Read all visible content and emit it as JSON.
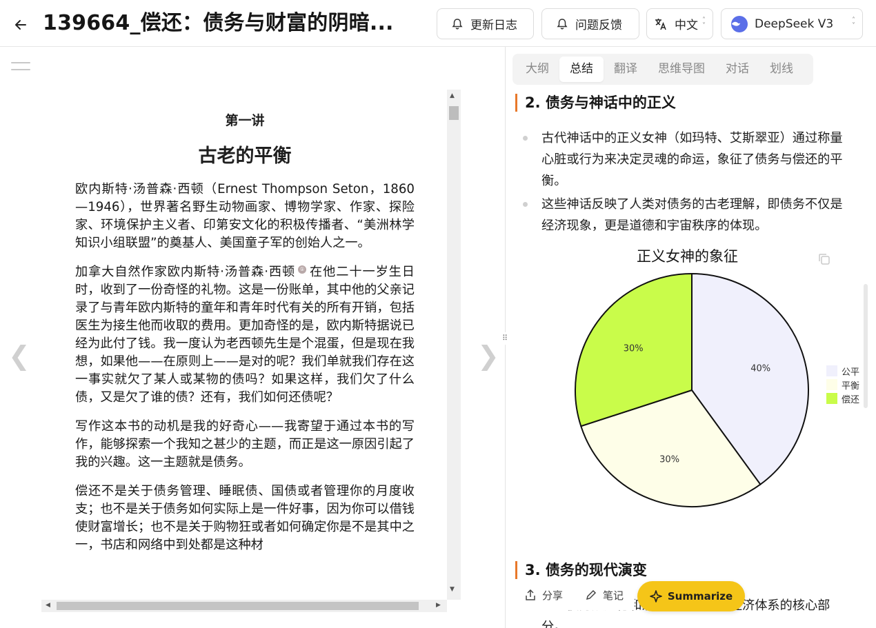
{
  "header": {
    "title": "139664_偿还：债务与财富的阴暗...",
    "changelog_label": "更新日志",
    "feedback_label": "问题反馈",
    "language_label": "中文",
    "model_label": "DeepSeek V3"
  },
  "reader": {
    "lecture": "第一讲",
    "chapter_title": "古老的平衡",
    "paragraphs": [
      "欧内斯特·汤普森·西顿（Ernest Thompson Seton，1860—1946），世界著名野生动物画家、博物学家、作家、探险家、环境保护主义者、印第安文化的积极传播者、“美洲林学知识小组联盟”的奠基人、美国童子军的创始人之一。",
      "在他二十一岁生日时，收到了一份奇怪的礼物。这是一份账单，其中他的父亲记录了与青年欧内斯特的童年和青年时代有关的所有开销，包括医生为接生他而收取的费用。更加奇怪的是，欧内斯特据说已经为此付了钱。我一度认为老西顿先生是个混蛋，但是现在我想，如果他——在原则上——是对的呢？我们单就我们存在这一事实就欠了某人或某物的债吗？如果这样，我们欠了什么债，又是欠了谁的债？还有，我们如何还债呢？",
      "写作这本书的动机是我的好奇心——我寄望于通过本书的写作，能够探索一个我知之甚少的主题，而正是这一原因引起了我的兴趣。这一主题就是债务。",
      "偿还不是关于债务管理、睡眠债、国债或者管理你的月度收支；也不是关于债务如何实际上是一件好事，因为你可以借钱使财富增长；也不是关于购物狂或者如何确定你是不是其中之一，书店和网络中到处都是这种材"
    ],
    "para2_prefix": "加拿大自然作家欧内斯特·汤普森·西顿",
    "note_marker": "①"
  },
  "tabs": [
    "大纲",
    "总结",
    "翻译",
    "思维导图",
    "对话",
    "划线"
  ],
  "active_tab": "总结",
  "summary": {
    "section2_title": "2. 债务与神话中的正义",
    "bullets": [
      "古代神话中的正义女神（如玛特、艾斯翠亚）通过称量心脏或行为来决定灵魂的命运，象征了债务与偿还的平衡。",
      "这些神话反映了人类对债务的古老理解，即债务不仅是经济现象，更是道德和宇宙秩序的体现。"
    ],
    "section3_title": "3. 债务的现代演变",
    "tail_text": "……债务从道德和宗教问题演变为经济体系的核心部分。"
  },
  "chart_data": {
    "type": "pie",
    "title": "正义女神的象征",
    "categories": [
      "公平",
      "平衡",
      "偿还"
    ],
    "values": [
      40,
      30,
      30
    ],
    "labels": [
      "40%",
      "30%",
      "30%"
    ],
    "colors": [
      "#f0f0fc",
      "#fefee8",
      "#c9fc4a"
    ],
    "legend_position": "right"
  },
  "actions": {
    "share_label": "分享",
    "notes_label": "笔记",
    "summarize_label": "Summarize"
  }
}
